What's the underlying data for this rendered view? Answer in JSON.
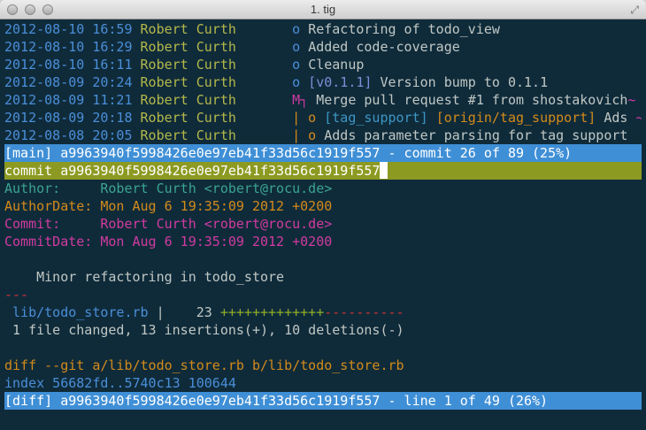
{
  "window": {
    "title": "1. tig"
  },
  "log": [
    {
      "date": "2012-08-10 16:59",
      "author": "Robert Curth",
      "graph": "o",
      "refs": [],
      "subject": "Refactoring of todo_view"
    },
    {
      "date": "2012-08-10 16:29",
      "author": "Robert Curth",
      "graph": "o",
      "refs": [],
      "subject": "Added code-coverage"
    },
    {
      "date": "2012-08-10 16:11",
      "author": "Robert Curth",
      "graph": "o",
      "refs": [],
      "subject": "Cleanup"
    },
    {
      "date": "2012-08-09 20:24",
      "author": "Robert Curth",
      "graph": "o",
      "tag": "[v0.1.1]",
      "subject": "Version bump to 0.1.1"
    },
    {
      "date": "2012-08-09 11:21",
      "author": "Robert Curth",
      "graph": "M┐",
      "subject": "Merge pull request #1 from shostakovich",
      "more": "~"
    },
    {
      "date": "2012-08-09 20:18",
      "author": "Robert Curth",
      "graph": "| o",
      "tag": "[tag_support]",
      "remote": "[origin/tag_support]",
      "subject": "Ads",
      "more": "~"
    },
    {
      "date": "2012-08-08 20:05",
      "author": "Robert Curth",
      "graph": "| o",
      "subject": "Adds parameter parsing for tag support"
    }
  ],
  "main_status": "[main] a9963940f5998426e0e97eb41f33d56c1919f557 - commit 26 of 89 (25%)",
  "diff": {
    "commit_line": "commit a9963940f5998426e0e97eb41f33d56c1919f557",
    "author_label": "Author:",
    "author_value": "Robert Curth <robert@rocu.de>",
    "authordate_label": "AuthorDate:",
    "authordate_value": "Mon Aug 6 19:35:09 2012 +0200",
    "committer_label": "Commit:",
    "committer_value": "Robert Curth <robert@rocu.de>",
    "commitdate_label": "CommitDate:",
    "commitdate_value": "Mon Aug 6 19:35:09 2012 +0200",
    "message": "Minor refactoring in todo_store",
    "separator": "---",
    "stat_file": "lib/todo_store.rb",
    "stat_count": "23",
    "stat_plus": "+++++++++++++",
    "stat_minus": "----------",
    "summary": "1 file changed, 13 insertions(+), 10 deletions(-)",
    "git_header": "diff --git a/lib/todo_store.rb b/lib/todo_store.rb",
    "index_line": "index 56682fd..5740c13 100644"
  },
  "diff_status": "[diff] a9963940f5998426e0e97eb41f33d56c1919f557 - line 1 of 49 (26%)"
}
